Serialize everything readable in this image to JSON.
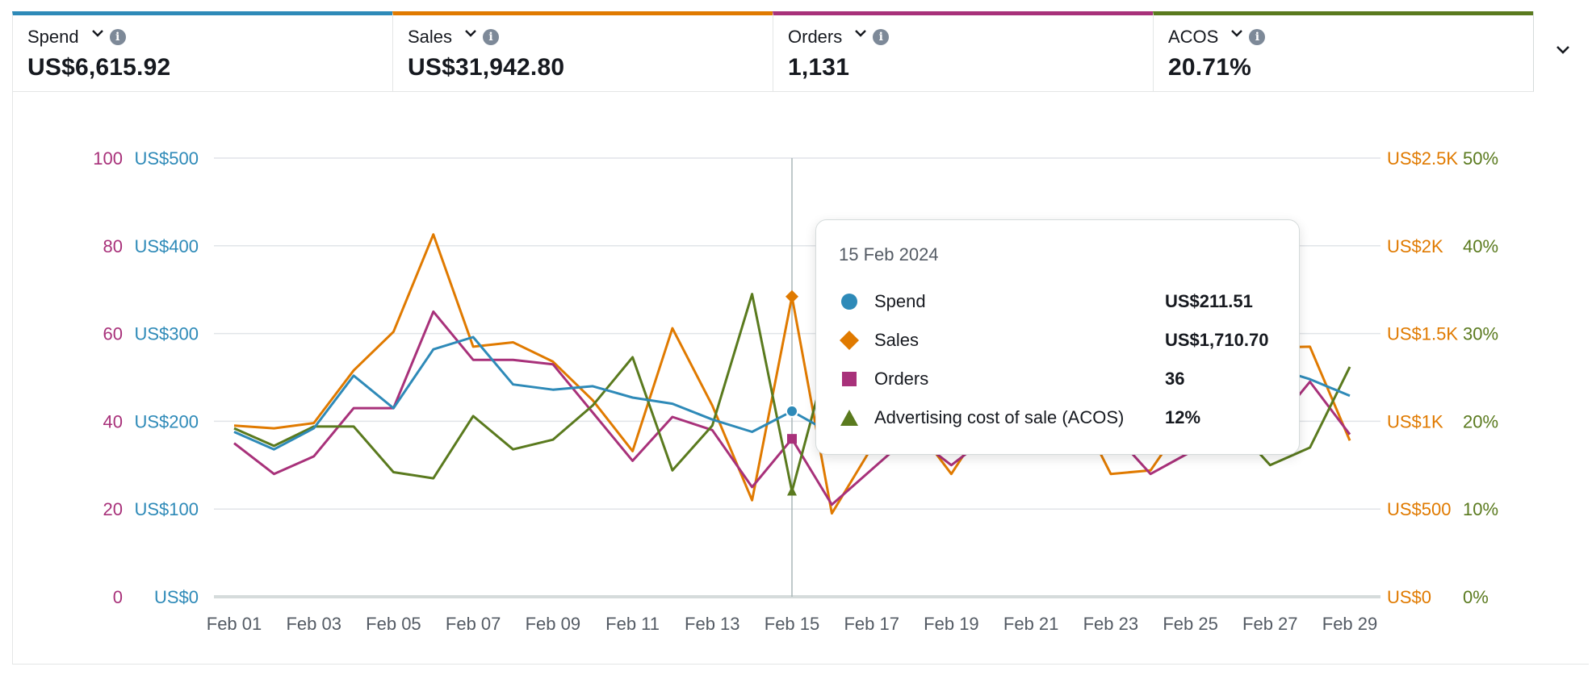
{
  "metrics": [
    {
      "label": "Spend",
      "value": "US$6,615.92",
      "color": "#2e8ab8"
    },
    {
      "label": "Sales",
      "value": "US$31,942.80",
      "color": "#e07a00"
    },
    {
      "label": "Orders",
      "value": "1,131",
      "color": "#a8317a"
    },
    {
      "label": "ACOS",
      "value": "20.71%",
      "color": "#5a7a1e"
    }
  ],
  "tooltip": {
    "date": "15 Feb 2024",
    "rows": [
      {
        "name": "Spend",
        "value": "US$211.51"
      },
      {
        "name": "Sales",
        "value": "US$1,710.70"
      },
      {
        "name": "Orders",
        "value": "36"
      },
      {
        "name": "Advertising cost of sale (ACOS)",
        "value": "12%"
      }
    ]
  },
  "chart_data": {
    "type": "line",
    "x": [
      "Feb 01",
      "Feb 02",
      "Feb 03",
      "Feb 04",
      "Feb 05",
      "Feb 06",
      "Feb 07",
      "Feb 08",
      "Feb 09",
      "Feb 10",
      "Feb 11",
      "Feb 12",
      "Feb 13",
      "Feb 14",
      "Feb 15",
      "Feb 16",
      "Feb 17",
      "Feb 18",
      "Feb 19",
      "Feb 20",
      "Feb 21",
      "Feb 22",
      "Feb 23",
      "Feb 24",
      "Feb 25",
      "Feb 26",
      "Feb 27",
      "Feb 28",
      "Feb 29"
    ],
    "x_tick_labels": [
      "Feb 01",
      "Feb 03",
      "Feb 05",
      "Feb 07",
      "Feb 09",
      "Feb 11",
      "Feb 13",
      "Feb 15",
      "Feb 17",
      "Feb 19",
      "Feb 21",
      "Feb 23",
      "Feb 25",
      "Feb 27",
      "Feb 29"
    ],
    "grid": true,
    "series": [
      {
        "name": "Spend",
        "color": "#2e8ab8",
        "axis": "spend",
        "values": [
          188,
          168,
          192,
          252,
          215,
          282,
          296,
          242,
          236,
          240,
          227,
          220,
          202,
          188,
          211.51,
          186,
          196,
          204,
          212,
          220,
          226,
          232,
          238,
          244,
          250,
          256,
          262,
          248,
          229
        ]
      },
      {
        "name": "Sales",
        "color": "#e07a00",
        "axis": "sales",
        "values": [
          975,
          960,
          990,
          1290,
          1510,
          2065,
          1425,
          1450,
          1340,
          1120,
          830,
          1530,
          1090,
          550,
          1710.7,
          475,
          850,
          1000,
          700,
          1050,
          1100,
          1150,
          700,
          720,
          1050,
          1250,
          1420,
          1425,
          890
        ]
      },
      {
        "name": "Orders",
        "color": "#a8317a",
        "axis": "orders",
        "values": [
          35,
          28,
          32,
          43,
          43,
          65,
          54,
          54,
          53,
          42,
          31,
          41,
          38,
          25,
          36,
          21,
          29,
          37,
          30,
          37,
          39,
          40,
          38,
          28,
          33,
          36,
          38,
          49,
          37
        ]
      },
      {
        "name": "Advertising cost of sale (ACOS)",
        "color": "#5a7a1e",
        "axis": "acos",
        "values": [
          19.2,
          17.2,
          19.4,
          19.4,
          14.2,
          13.5,
          20.6,
          16.8,
          17.9,
          21.8,
          27.3,
          14.4,
          19.5,
          34.5,
          12,
          29,
          27,
          25,
          24,
          23,
          22,
          21,
          20,
          18,
          19,
          20,
          15,
          17,
          26.2
        ]
      }
    ],
    "axes": {
      "orders": {
        "ticks": [
          "0",
          "20",
          "40",
          "60",
          "80",
          "100"
        ],
        "ylim": [
          0,
          100
        ],
        "color": "#a8317a"
      },
      "spend": {
        "ticks": [
          "US$0",
          "US$100",
          "US$200",
          "US$300",
          "US$400",
          "US$500"
        ],
        "ylim": [
          0,
          500
        ],
        "color": "#2e8ab8"
      },
      "sales": {
        "ticks": [
          "US$0",
          "US$500",
          "US$1K",
          "US$1.5K",
          "US$2K",
          "US$2.5K"
        ],
        "ylim": [
          0,
          2500
        ],
        "color": "#e07a00"
      },
      "acos": {
        "ticks": [
          "0%",
          "10%",
          "20%",
          "30%",
          "40%",
          "50%"
        ],
        "ylim": [
          0,
          50
        ],
        "color": "#5a7a1e"
      }
    },
    "highlight": {
      "x": "Feb 15"
    }
  }
}
